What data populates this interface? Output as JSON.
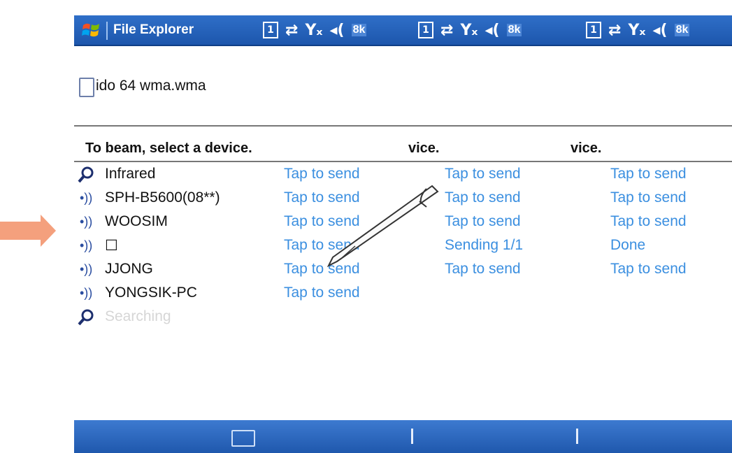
{
  "colors": {
    "titlebar": "#1f5bb0",
    "link": "#3b8fe0",
    "arrow": "#f4a07d"
  },
  "titlebar": {
    "title": "File Explorer",
    "clock": "8k"
  },
  "file": {
    "name": "ido 64 wma.wma"
  },
  "headings": [
    "To beam, select a device.",
    "vice.",
    "vice."
  ],
  "devices": [
    {
      "icon": "search-icon",
      "name": "Infrared",
      "status": [
        "Tap to send",
        "Tap to send",
        "Tap to send"
      ]
    },
    {
      "icon": "beam-icon",
      "name": "SPH-B5600(08**)",
      "status": [
        "Tap to send",
        "Tap to send",
        "Tap to send"
      ]
    },
    {
      "icon": "beam-icon",
      "name": "WOOSIM",
      "status": [
        "Tap to send",
        "Tap to send",
        "Tap to send"
      ]
    },
    {
      "icon": "beam-icon",
      "name": "☐",
      "status": [
        "Tap to send",
        "Sending 1/1",
        "Done"
      ]
    },
    {
      "icon": "beam-icon",
      "name": "JJONG",
      "status": [
        "Tap to send",
        "Tap to send",
        "Tap to send"
      ]
    },
    {
      "icon": "beam-icon",
      "name": "YONGSIK-PC",
      "status": [
        "Tap to send",
        "",
        ""
      ]
    }
  ],
  "searching": {
    "label": "Searching"
  }
}
